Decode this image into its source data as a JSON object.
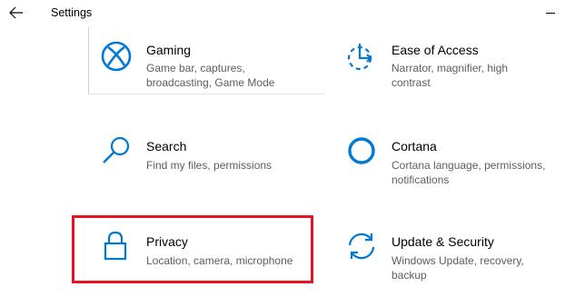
{
  "window": {
    "title": "Settings"
  },
  "accent": "#0078d7",
  "highlight_color": "#e81123",
  "tiles": [
    {
      "name": "Gaming",
      "desc": "Game bar, captures, broadcasting, Game Mode",
      "icon": "xbox-icon"
    },
    {
      "name": "Ease of Access",
      "desc": "Narrator, magnifier, high contrast",
      "icon": "ease-of-access-icon"
    },
    {
      "name": "Search",
      "desc": "Find my files, permissions",
      "icon": "search-icon"
    },
    {
      "name": "Cortana",
      "desc": "Cortana language, permissions, notifications",
      "icon": "cortana-icon"
    },
    {
      "name": "Privacy",
      "desc": "Location, camera, microphone",
      "icon": "lock-icon"
    },
    {
      "name": "Update & Security",
      "desc": "Windows Update, recovery, backup",
      "icon": "sync-icon"
    }
  ]
}
